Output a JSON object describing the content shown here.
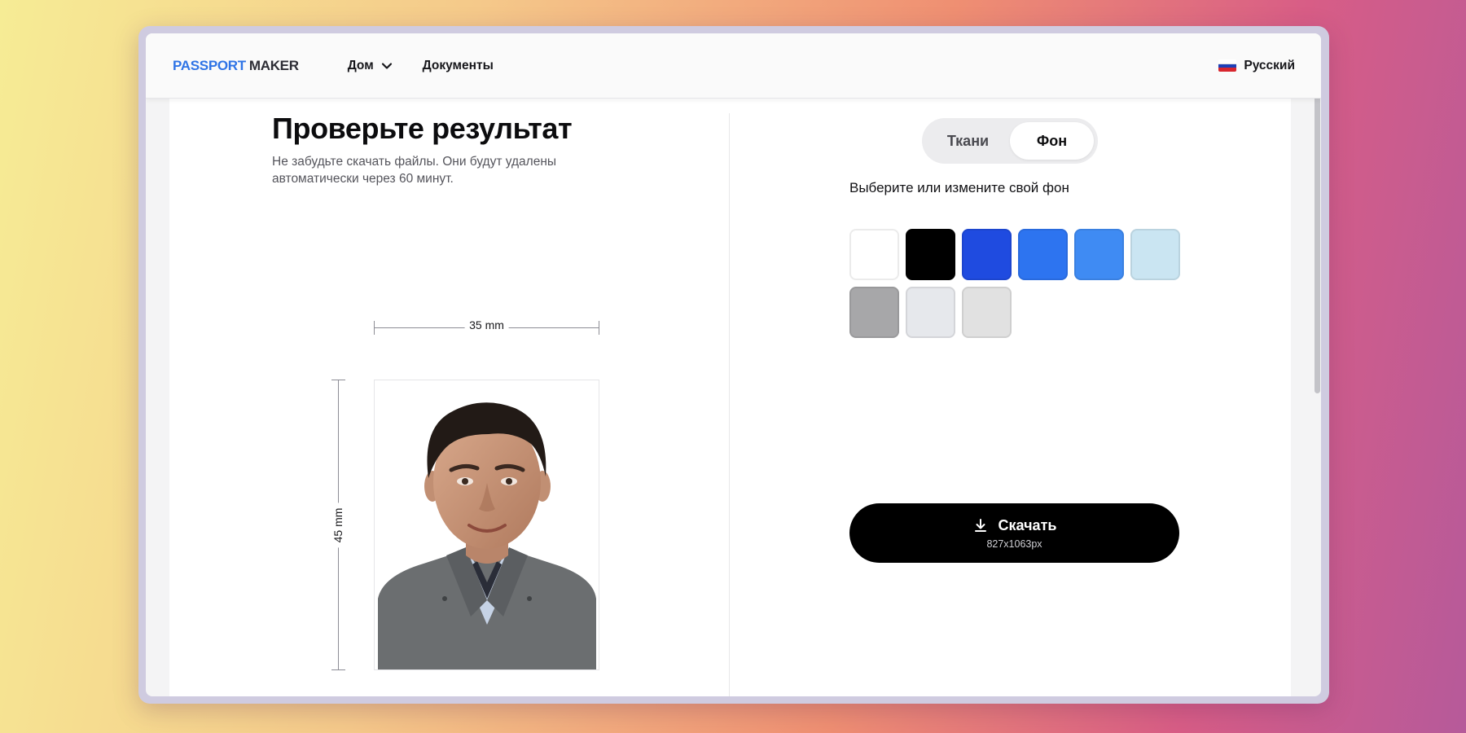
{
  "brand": {
    "part1": "PASSPORT",
    "part2": "MAKER",
    "color": "#2f74e6"
  },
  "nav": {
    "home": "Дом",
    "docs": "Документы",
    "language": "Русский"
  },
  "result": {
    "title": "Проверьте результат",
    "subtitle": "Не забудьте скачать файлы. Они будут удалены автоматически через 60 минут.",
    "width_label": "35 mm",
    "height_label": "45 mm"
  },
  "tabs": [
    {
      "label": "Ткани",
      "active": false
    },
    {
      "label": "Фон",
      "active": true
    }
  ],
  "background": {
    "prompt": "Выберите или измените свой фон",
    "colors": [
      "#ffffff",
      "#000000",
      "#1f4be0",
      "#2d74f0",
      "#3f8bf3",
      "#cae5f2",
      "#a7a7a9",
      "#e6e8ec",
      "#e1e1e1"
    ]
  },
  "download": {
    "label": "Скачать",
    "size": "827x1063px"
  }
}
